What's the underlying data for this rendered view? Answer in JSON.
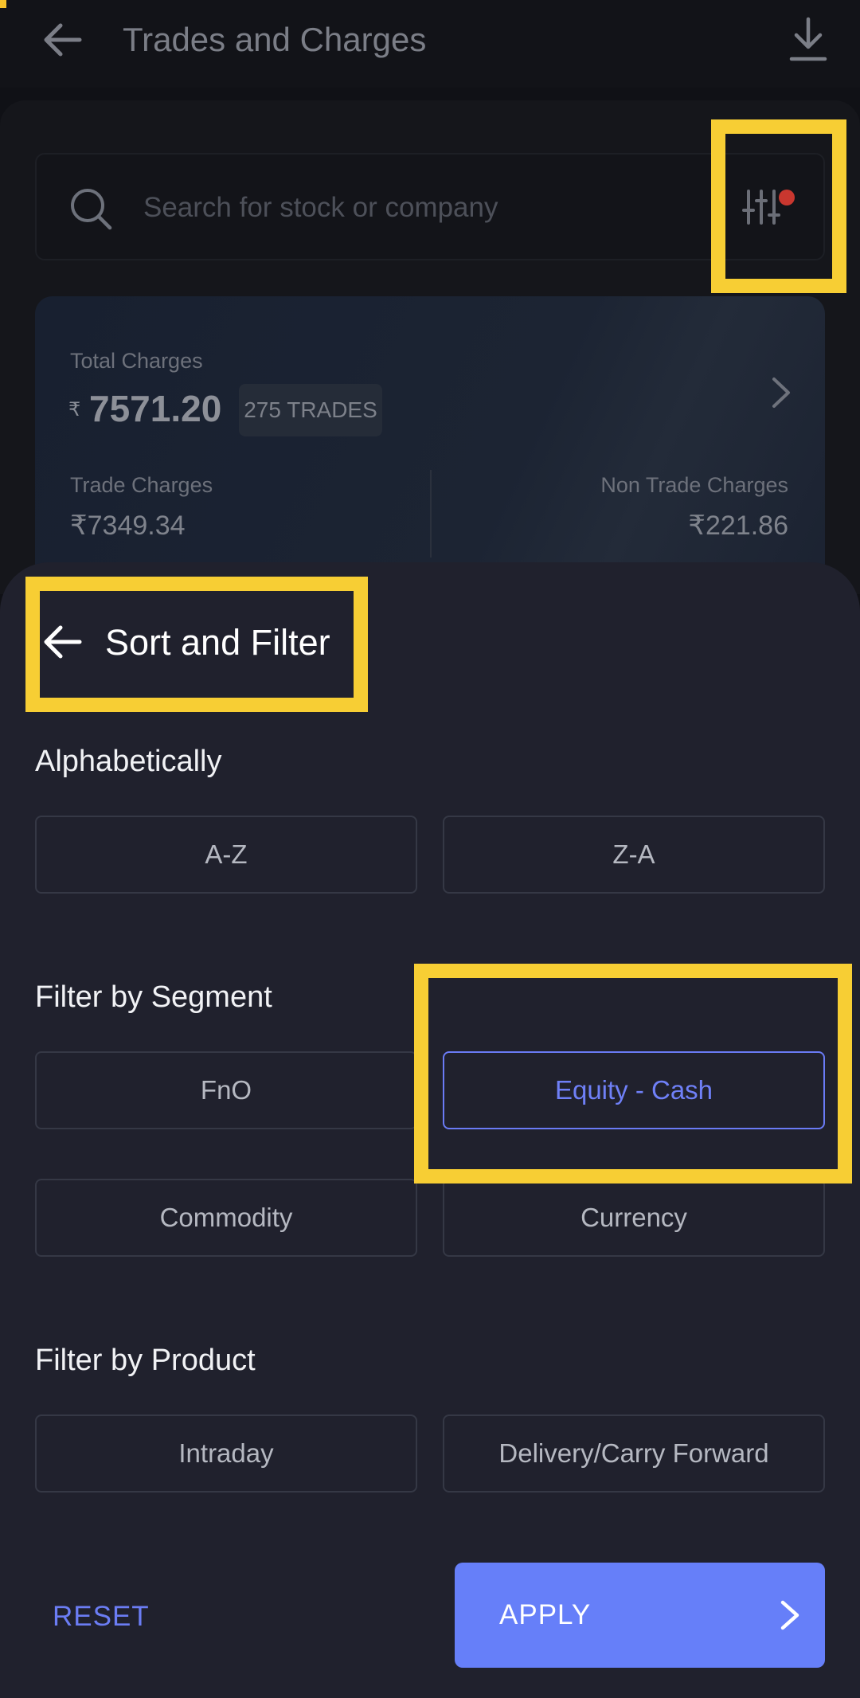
{
  "header": {
    "title": "Trades and Charges",
    "icons": {
      "back": "back-arrow-icon",
      "download": "download-icon"
    }
  },
  "search": {
    "placeholder": "Search for stock or company",
    "icon": "search-icon",
    "filter_icon": "sliders-filter-icon",
    "filter_active_dot_color": "#c9372f"
  },
  "summary": {
    "total_label": "Total Charges",
    "currency_symbol": "₹",
    "total_value": "7571.20",
    "trades_badge": "275 TRADES",
    "trade_charges_label": "Trade Charges",
    "trade_charges_value": "₹7349.34",
    "non_trade_charges_label": "Non Trade Charges",
    "non_trade_charges_value": "₹221.86"
  },
  "sheet": {
    "title": "Sort and Filter",
    "sections": [
      {
        "title": "Alphabetically",
        "options": [
          "A-Z",
          "Z-A"
        ]
      },
      {
        "title": "Filter by Segment",
        "options": [
          "FnO",
          "Equity - Cash",
          "Commodity",
          "Currency"
        ],
        "selected": "Equity - Cash"
      },
      {
        "title": "Filter by Product",
        "options": [
          "Intraday",
          "Delivery/Carry Forward"
        ]
      }
    ],
    "reset_label": "RESET",
    "apply_label": "APPLY"
  },
  "colors": {
    "accent": "#667ff9",
    "highlight_box": "#f7ce34",
    "sheet_bg": "#20212d",
    "page_bg": "#101116"
  }
}
